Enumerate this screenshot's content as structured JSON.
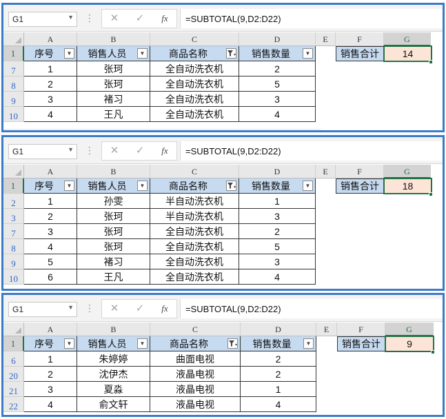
{
  "panels": [
    {
      "name_box": "G1",
      "formula": "=SUBTOTAL(9,D2:D22)",
      "columns": [
        "A",
        "B",
        "C",
        "D",
        "E",
        "F",
        "G"
      ],
      "headers": [
        "序号",
        "销售人员",
        "商品名称",
        "销售数量"
      ],
      "label": "销售合计",
      "total": "14",
      "rows": [
        {
          "row": "7",
          "cells": [
            "1",
            "张珂",
            "全自动洗衣机",
            "2"
          ]
        },
        {
          "row": "8",
          "cells": [
            "2",
            "张珂",
            "全自动洗衣机",
            "5"
          ]
        },
        {
          "row": "9",
          "cells": [
            "3",
            "褚习",
            "全自动洗衣机",
            "3"
          ]
        },
        {
          "row": "10",
          "cells": [
            "4",
            "王凡",
            "全自动洗衣机",
            "4"
          ]
        }
      ]
    },
    {
      "name_box": "G1",
      "formula": "=SUBTOTAL(9,D2:D22)",
      "columns": [
        "A",
        "B",
        "C",
        "D",
        "E",
        "F",
        "G"
      ],
      "headers": [
        "序号",
        "销售人员",
        "商品名称",
        "销售数量"
      ],
      "label": "销售合计",
      "total": "18",
      "rows": [
        {
          "row": "2",
          "cells": [
            "1",
            "孙雯",
            "半自动洗衣机",
            "1"
          ]
        },
        {
          "row": "3",
          "cells": [
            "2",
            "张珂",
            "半自动洗衣机",
            "3"
          ]
        },
        {
          "row": "7",
          "cells": [
            "3",
            "张珂",
            "全自动洗衣机",
            "2"
          ]
        },
        {
          "row": "8",
          "cells": [
            "4",
            "张珂",
            "全自动洗衣机",
            "5"
          ]
        },
        {
          "row": "9",
          "cells": [
            "5",
            "褚习",
            "全自动洗衣机",
            "3"
          ]
        },
        {
          "row": "10",
          "cells": [
            "6",
            "王凡",
            "全自动洗衣机",
            "4"
          ]
        }
      ]
    },
    {
      "name_box": "G1",
      "formula": "=SUBTOTAL(9,D2:D22)",
      "columns": [
        "A",
        "B",
        "C",
        "D",
        "E",
        "F",
        "G"
      ],
      "headers": [
        "序号",
        "销售人员",
        "商品名称",
        "销售数量"
      ],
      "label": "销售合计",
      "total": "9",
      "rows": [
        {
          "row": "6",
          "cells": [
            "1",
            "朱婷婷",
            "曲面电视",
            "2"
          ]
        },
        {
          "row": "20",
          "cells": [
            "2",
            "沈伊杰",
            "液晶电视",
            "2"
          ]
        },
        {
          "row": "21",
          "cells": [
            "3",
            "夏淼",
            "液晶电视",
            "1"
          ]
        },
        {
          "row": "22",
          "cells": [
            "4",
            "俞文轩",
            "液晶电视",
            "4"
          ]
        }
      ]
    }
  ],
  "icons": {
    "cancel": "✕",
    "enter": "✓",
    "function": "fx",
    "dropdown": "▼",
    "filter_active": "funnel"
  },
  "colors": {
    "panel_border": "#3a7bc8",
    "header_fill": "#c6daf0",
    "total_fill": "#fce4d6",
    "selection": "#217346"
  }
}
